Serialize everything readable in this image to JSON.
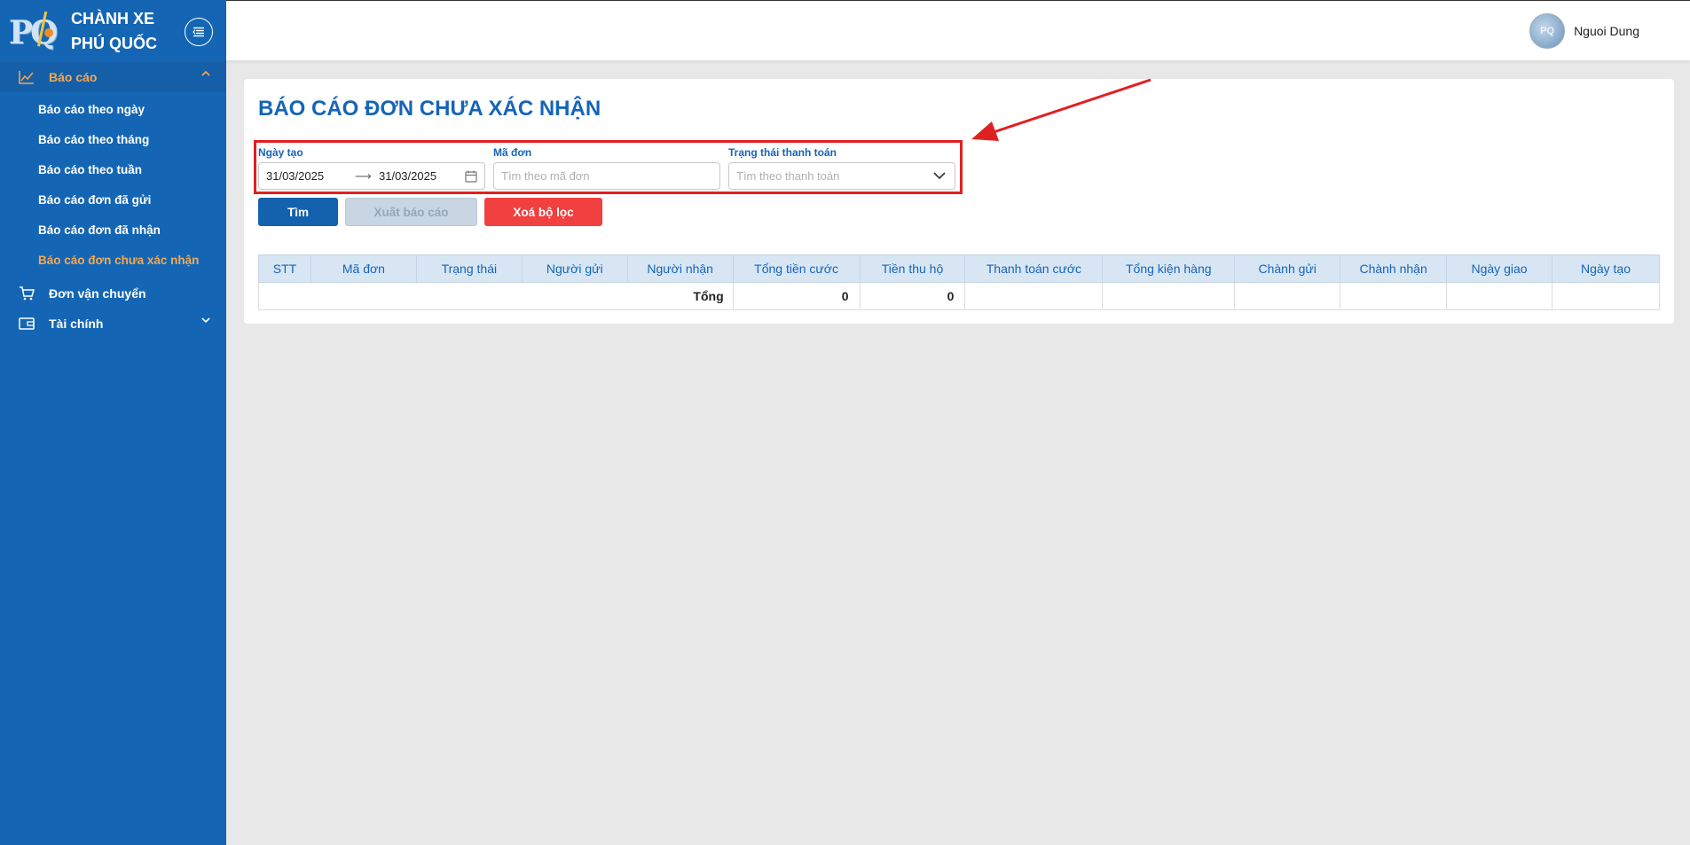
{
  "brand": {
    "logo_text": "PQ",
    "name": "CHÀNH XE PHÚ QUỐC"
  },
  "sidebar": {
    "report_menu": "Báo cáo",
    "report_items": [
      "Báo cáo theo ngày",
      "Báo cáo theo tháng",
      "Báo cáo theo tuần",
      "Báo cáo đơn đã gửi",
      "Báo cáo đơn đã nhận",
      "Báo cáo đơn chưa xác nhận"
    ],
    "shipping_menu": "Đơn vận chuyển",
    "finance_menu": "Tài chính",
    "icons": [
      "chart-line-icon",
      "cart-icon",
      "wallet-icon"
    ]
  },
  "header": {
    "user_name": "Nguoi Dung",
    "avatar_text": "PQ"
  },
  "page": {
    "title": "BÁO CÁO ĐƠN CHƯA XÁC NHẬN"
  },
  "filters": {
    "created_label": "Ngày tạo",
    "date_from": "31/03/2025",
    "date_to": "31/03/2025",
    "order_label": "Mã đơn",
    "order_placeholder": "Tìm theo mã đơn",
    "payment_label": "Trạng thái thanh toán",
    "payment_placeholder": "Tìm theo thanh toán"
  },
  "buttons": {
    "find": "Tìm",
    "export": "Xuất báo cáo",
    "clear": "Xoá bộ lọc"
  },
  "table": {
    "columns": [
      "STT",
      "Mã đơn",
      "Trạng thái",
      "Người gửi",
      "Người nhận",
      "Tổng tiền cước",
      "Tiền thu hộ",
      "Thanh toán cước",
      "Tổng kiện hàng",
      "Chành gửi",
      "Chành nhận",
      "Ngày giao",
      "Ngày tạo"
    ],
    "total_label": "Tổng",
    "total_fee": "0",
    "total_cod": "0"
  },
  "colors": {
    "sidebar": "#1466b4",
    "accent": "#f5a851",
    "primary": "#1461ad",
    "danger": "#f14040",
    "highlight": "#e02020"
  }
}
